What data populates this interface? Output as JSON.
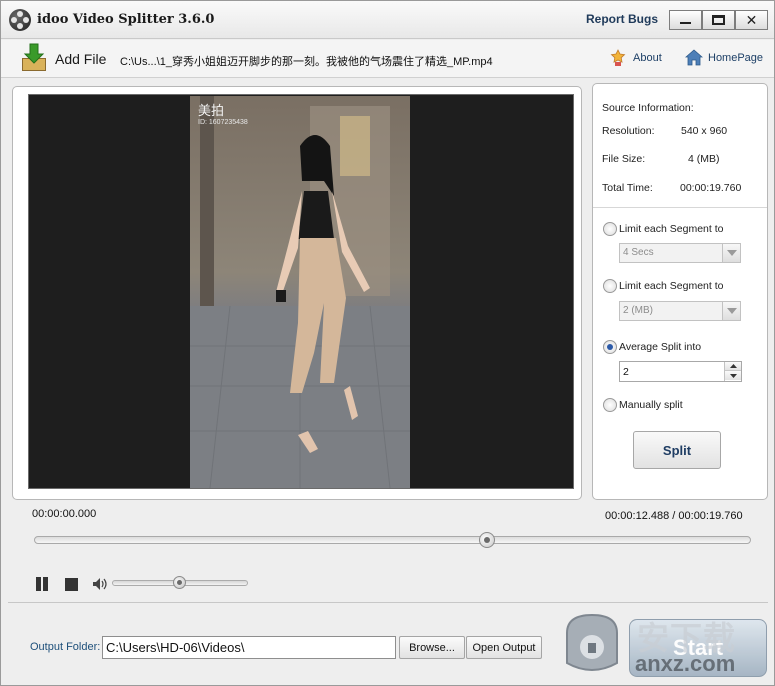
{
  "titlebar": {
    "app_title": "idoo Video Splitter 3.6.0",
    "report_bugs": "Report Bugs",
    "close_glyph": "✕"
  },
  "toolbar": {
    "add_file": "Add File",
    "file_path": "C:\\Us...\\1_穿秀小姐姐迈开脚步的那一刻。我被他的气场震住了精选_MP.mp4",
    "about": "About",
    "homepage": "HomePage"
  },
  "video": {
    "watermark_title": "美拍",
    "watermark_id": "ID: 1607235438"
  },
  "source_info": {
    "heading": "Source Information:",
    "resolution_label": "Resolution:",
    "resolution_value": "540 x 960",
    "filesize_label": "File Size:",
    "filesize_value": "4 (MB)",
    "totaltime_label": "Total Time:",
    "totaltime_value": "00:00:19.760"
  },
  "options": {
    "limit_time_label": "Limit each Segment to",
    "limit_time_value": "4 Secs",
    "limit_size_label": "Limit each Segment to",
    "limit_size_value": "2 (MB)",
    "average_label": "Average Split into",
    "average_value": "2",
    "manual_label": "Manually split",
    "selected": "average",
    "split_button": "Split"
  },
  "playback": {
    "start_time": "00:00:00.000",
    "position_text": "00:00:12.488 / 00:00:19.760",
    "seek_fraction": 0.632,
    "volume_fraction": 0.49
  },
  "output": {
    "label": "Output Folder:",
    "path": "C:\\Users\\HD-06\\Videos\\",
    "browse": "Browse...",
    "open_output": "Open Output",
    "start": "Start"
  },
  "watermark": {
    "cn": "安下载",
    "url": "anxz.com"
  },
  "colors": {
    "link_blue": "#1d3f66",
    "radio_selected": "#2c5aa8"
  },
  "icons": [
    "film-reel-icon",
    "add-file-icon",
    "about-icon",
    "home-icon",
    "pause-icon",
    "stop-icon",
    "volume-icon",
    "chevron-down-icon"
  ]
}
